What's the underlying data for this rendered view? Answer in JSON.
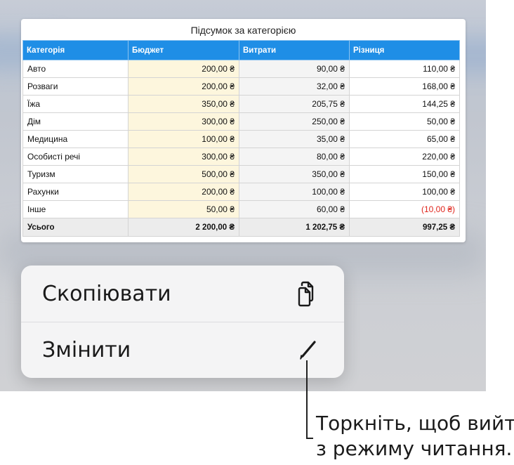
{
  "table": {
    "title": "Підсумок за категорією",
    "headers": [
      "Категорія",
      "Бюджет",
      "Витрати",
      "Різниця"
    ],
    "rows": [
      {
        "category": "Авто",
        "budget": "200,00 ₴",
        "spent": "90,00 ₴",
        "difference": "110,00 ₴"
      },
      {
        "category": "Розваги",
        "budget": "200,00 ₴",
        "spent": "32,00 ₴",
        "difference": "168,00 ₴"
      },
      {
        "category": "Їжа",
        "budget": "350,00 ₴",
        "spent": "205,75 ₴",
        "difference": "144,25 ₴"
      },
      {
        "category": "Дім",
        "budget": "300,00 ₴",
        "spent": "250,00 ₴",
        "difference": "50,00 ₴"
      },
      {
        "category": "Медицина",
        "budget": "100,00 ₴",
        "spent": "35,00 ₴",
        "difference": "65,00 ₴"
      },
      {
        "category": "Особисті речі",
        "budget": "300,00 ₴",
        "spent": "80,00 ₴",
        "difference": "220,00 ₴"
      },
      {
        "category": "Туризм",
        "budget": "500,00 ₴",
        "spent": "350,00 ₴",
        "difference": "150,00 ₴"
      },
      {
        "category": "Рахунки",
        "budget": "200,00 ₴",
        "spent": "100,00 ₴",
        "difference": "100,00 ₴"
      },
      {
        "category": "Інше",
        "budget": "50,00 ₴",
        "spent": "60,00 ₴",
        "difference": "(10,00 ₴)"
      }
    ],
    "total": {
      "category": "Усього",
      "budget": "2 200,00 ₴",
      "spent": "1 202,75 ₴",
      "difference": "997,25 ₴"
    },
    "colors": {
      "header": "#1f8ee6",
      "budget_fill": "#fdf6dd",
      "negative": "#e0261d"
    }
  },
  "context_menu": {
    "copy": {
      "label": "Скопіювати",
      "icon": "copy-icon"
    },
    "edit": {
      "label": "Змінити",
      "icon": "pencil-icon"
    }
  },
  "callout": {
    "line1": "Торкніть, щоб вийти",
    "line2": "з режиму читання."
  }
}
